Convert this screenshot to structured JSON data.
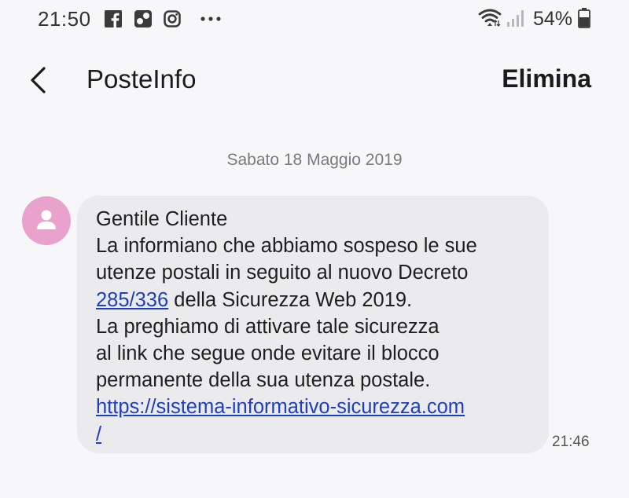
{
  "status_bar": {
    "time": "21:50",
    "battery_percent": "54%",
    "icons": [
      "facebook-icon",
      "flickr-icon",
      "instagram-icon",
      "more-icon",
      "wifi-icon",
      "signal-icon",
      "battery-icon"
    ]
  },
  "header": {
    "title": "PosteInfo",
    "delete_label": "Elimina",
    "back_icon": "back-arrow-icon"
  },
  "conversation": {
    "date_separator": "Sabato 18 Maggio 2019",
    "avatar_icon": "person-icon",
    "avatar_color": "#e8a2cb",
    "message": {
      "line1": "Gentile Cliente",
      "line2": "La informiano che abbiamo sospeso le sue",
      "line3": "utenze postali in seguito al nuovo Decreto",
      "line4_link": "285/336",
      "line4_rest": " della Sicurezza Web 2019.",
      "line5": "La preghiamo di attivare tale sicurezza",
      "line6": "al link che segue onde evitare il blocco",
      "line7": "permanente della sua utenza postale.",
      "url_part1": "https://sistema-informativo-sicurezza.com",
      "url_part2": "/",
      "time": "21:46"
    },
    "link_color": "#1d3fbf",
    "bubble_color": "#ebebee"
  }
}
